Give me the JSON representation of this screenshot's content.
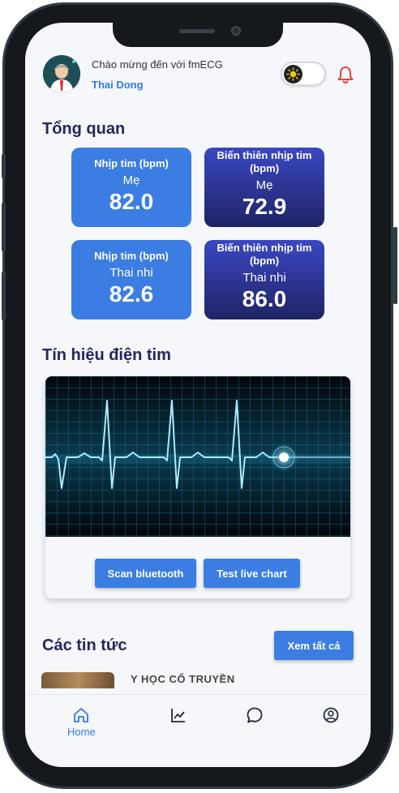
{
  "header": {
    "greeting": "Chào mừng đến với fmECG",
    "user_name": "Thai Dong"
  },
  "overview": {
    "title": "Tổng quan",
    "cards": [
      {
        "label": "Nhịp tim (bpm)",
        "subject": "Mẹ",
        "value": "82.0",
        "style": "light"
      },
      {
        "label": "Biến thiên nhịp tim (bpm)",
        "subject": "Mẹ",
        "value": "72.9",
        "style": "dark"
      },
      {
        "label": "Nhịp tim (bpm)",
        "subject": "Thai nhi",
        "value": "82.6",
        "style": "light"
      },
      {
        "label": "Biến thiên nhịp tim (bpm)",
        "subject": "Thai nhi",
        "value": "86.0",
        "style": "dark"
      }
    ]
  },
  "ecg": {
    "title": "Tín hiệu điện tim",
    "scan_label": "Scan bluetooth",
    "live_label": "Test live chart"
  },
  "news": {
    "title": "Các tin tức",
    "see_all_label": "Xem tất cả",
    "first_item_tag": "Y HỌC CỔ TRUYỀN"
  },
  "tabbar": {
    "home_label": "Home",
    "active_tab": "home"
  },
  "colors": {
    "accent": "#3b7de3",
    "title_text": "#22285c",
    "card_dark": "#1f2466",
    "bell": "#e0463c"
  },
  "icons": [
    "moon-sun-icon",
    "bell-icon",
    "home-icon",
    "chart-icon",
    "chat-icon",
    "profile-icon"
  ]
}
